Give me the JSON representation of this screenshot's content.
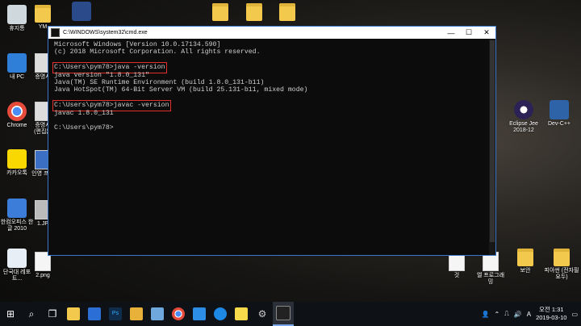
{
  "desktop": {
    "left_icons": [
      {
        "label": "휴지통",
        "color": "#cfd8dc",
        "icon": "recycle-bin-icon"
      },
      {
        "label": "내 PC",
        "color": "#2f7fd8",
        "icon": "pc-icon"
      },
      {
        "label": "Chrome",
        "color": "#e64a3b",
        "icon": "chrome-icon"
      },
      {
        "label": "카카오톡",
        "color": "#f8d800",
        "icon": "kakaotalk-icon"
      },
      {
        "label": "한컴오피스 한글 2010",
        "color": "#3b7dd8",
        "icon": "hancom-icon"
      },
      {
        "label": "단국대 레포트...",
        "color": "#e8eef5",
        "icon": "document-icon"
      }
    ],
    "second_column_labels": [
      "YM",
      "증명사",
      "증명사 (편집본",
      "인영 프로",
      "1.JP",
      "2.png"
    ],
    "right_icons": [
      {
        "label": "Eclipse Jee 2018-12",
        "icon": "eclipse-icon"
      },
      {
        "label": "Dev-C++",
        "icon": "devcpp-icon"
      }
    ],
    "bottom_right_labels": [
      "것",
      "엘 프로그래밍",
      "보안",
      "피아썬 (전자필요두)"
    ]
  },
  "cmd_window": {
    "title": "C:\\WINDOWS\\system32\\cmd.exe",
    "minimize": "—",
    "maximize": "☐",
    "close": "✕",
    "lines": [
      "Microsoft Windows [Version 10.0.17134.590]",
      "(c) 2018 Microsoft Corporation. All rights reserved.",
      "",
      "C:\\Users\\pym78>java -version",
      "java version \"1.8.0_131\"",
      "Java(TM) SE Runtime Environment (build 1.8.0_131-b11)",
      "Java HotSpot(TM) 64-Bit Server VM (build 25.131-b11, mixed mode)",
      "",
      "C:\\Users\\pym78>javac -version",
      "javac 1.8.0_131",
      "",
      "C:\\Users\\pym78>"
    ],
    "prompt": "C:\\Users\\pym78>",
    "cmd1": "java -version",
    "cmd2": "javac -version"
  },
  "taskbar": {
    "apps": [
      {
        "name": "start-icon",
        "glyph": "⊞",
        "color": "#ffffff"
      },
      {
        "name": "search-icon",
        "glyph": "⌕",
        "color": "#ffffff"
      },
      {
        "name": "task-view-icon",
        "glyph": "❐",
        "color": "#ffffff"
      },
      {
        "name": "file-explorer-icon",
        "glyph": "",
        "color": "#f2c94c"
      },
      {
        "name": "store-icon",
        "glyph": "",
        "color": "#2b6fd6"
      },
      {
        "name": "photoshop-icon",
        "glyph": "Ps",
        "color": "#0f2c4a"
      },
      {
        "name": "folder-icon",
        "glyph": "",
        "color": "#e8b23a"
      },
      {
        "name": "paint-icon",
        "glyph": "",
        "color": "#6fa8dc"
      },
      {
        "name": "chrome-icon",
        "glyph": "",
        "color": "#e64a3b"
      },
      {
        "name": "vscode-icon",
        "glyph": "",
        "color": "#2d8ee8"
      },
      {
        "name": "edge-icon",
        "glyph": "",
        "color": "#1e88e5"
      },
      {
        "name": "sticky-notes-icon",
        "glyph": "",
        "color": "#f7d94c"
      },
      {
        "name": "settings-icon",
        "glyph": "⚙",
        "color": "#cccccc"
      },
      {
        "name": "cmd-icon",
        "glyph": "",
        "color": "#222222"
      }
    ],
    "tray_icons": [
      "⌃",
      "⎍",
      "🔊",
      "A"
    ],
    "time": "오전 1:31",
    "date": "2019-03-10"
  }
}
